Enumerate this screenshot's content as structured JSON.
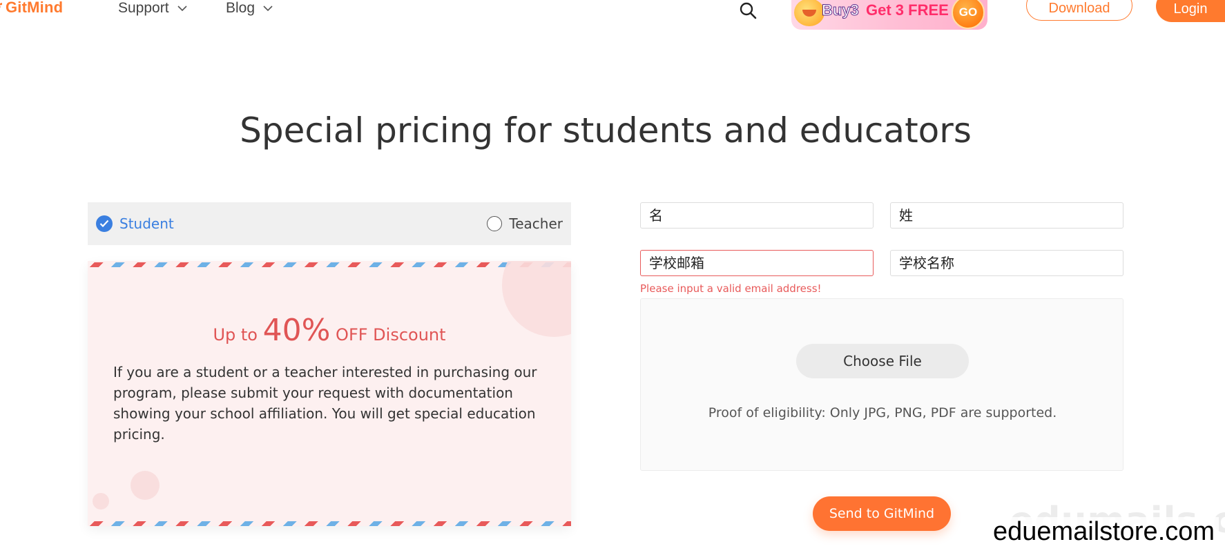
{
  "header": {
    "logo_text": "GitMind",
    "nav": [
      {
        "label": "Support"
      },
      {
        "label": "Blog"
      }
    ],
    "promo": {
      "part1": "Buy3",
      "part2": "Get 3 FREE",
      "go": "GO"
    },
    "download_label": "Download",
    "login_label": "Login"
  },
  "page_title": "Special pricing for students and educators",
  "tabs": [
    {
      "label": "Student",
      "selected": true
    },
    {
      "label": "Teacher",
      "selected": false
    }
  ],
  "card": {
    "headline_prefix": "Up to",
    "headline_percent": "40%",
    "headline_suffix": "OFF Discount",
    "description": "If you are a student or a teacher interested in purchasing our program, please submit your request with documentation showing your school affiliation. You will get special education pricing."
  },
  "form": {
    "first_name_placeholder": "名",
    "last_name_placeholder": "姓",
    "school_email_placeholder": "学校邮箱",
    "school_name_placeholder": "学校名称",
    "email_error": "Please input a valid email address!",
    "choose_file_label": "Choose File",
    "proof_text": "Proof of eligibility: Only JPG, PNG, PDF are supported.",
    "submit_label": "Send to GitMind"
  },
  "watermarks": {
    "faint": "edumails.cn",
    "main": "eduemailstore.com"
  },
  "colors": {
    "brand_orange": "#ff7a2e",
    "student_blue": "#3a7fe0",
    "discount_red": "#e05555",
    "error_red": "#e85a5a",
    "stripe_blue": "#6eb1e6"
  }
}
